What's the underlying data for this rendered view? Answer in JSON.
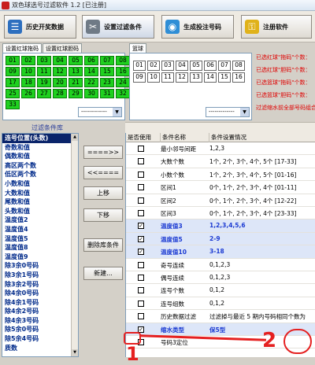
{
  "window": {
    "title": "双色球选号过滤软件 1.2 [已注册]"
  },
  "toolbar": [
    {
      "label": "历史开奖数据",
      "icon": "folder-icon",
      "color": "#2d6fbf",
      "glyph": "☰"
    },
    {
      "label": "设置过滤条件",
      "icon": "tools-icon",
      "color": "#6f7a86",
      "glyph": "✂"
    },
    {
      "label": "生成投注号码",
      "icon": "lottery-icon",
      "color": "#2f8ed6",
      "glyph": "◉"
    },
    {
      "label": "注册软件",
      "icon": "key-icon",
      "color": "#e0b21a",
      "glyph": "⚿"
    }
  ],
  "red_tabs": [
    "设置红球拖码",
    "设置红球胆码"
  ],
  "red_numbers": [
    "01",
    "02",
    "03",
    "04",
    "05",
    "06",
    "07",
    "08",
    "09",
    "10",
    "11",
    "12",
    "13",
    "14",
    "15",
    "16",
    "17",
    "18",
    "19",
    "20",
    "21",
    "22",
    "23",
    "24",
    "25",
    "26",
    "27",
    "28",
    "29",
    "30",
    "31",
    "32",
    "33"
  ],
  "blue_tabs": [
    "篮球"
  ],
  "blue_numbers": [
    "01",
    "02",
    "03",
    "04",
    "05",
    "06",
    "07",
    "08",
    "09",
    "10",
    "11",
    "12",
    "13",
    "14",
    "15",
    "16"
  ],
  "red_select_value": "-------------",
  "blue_select_value": "-------------",
  "status_lines": [
    "已选红球\"拖码\"个数：",
    "已选红球\"胆码\"个数：",
    "已选篮球\"拖码\"个数：",
    "已选篮球\"胆码\"个数：",
    "过滤缩水前全部号码组合"
  ],
  "library": {
    "header": "过滤条件库",
    "items": [
      "连号位置(头数)",
      "奇数和值",
      "偶数和值",
      "高区两个数",
      "低区两个数",
      "小数和值",
      "大数和值",
      "尾数和值",
      "头数和值",
      "温度值2",
      "温度值4",
      "温度值5",
      "温度值8",
      "温度值9",
      "除3余0号码",
      "除3余1号码",
      "除3余2号码",
      "除4余0号码",
      "除4余1号码",
      "除4余2号码",
      "除4余3号码",
      "除5余0号码",
      "除5余4号码",
      "质数"
    ],
    "selected_index": 0
  },
  "buttons": {
    "add": "====>>",
    "remove": "<<====",
    "up": "上移",
    "down": "下移",
    "delete": "删除库条件",
    "new": "新建..."
  },
  "table": {
    "headers": [
      "是否使用",
      "条件名称",
      "条件设置情况"
    ],
    "rows": [
      {
        "checked": false,
        "name": "最小邻号间距",
        "cond": "1,2,3",
        "highlight": false,
        "blue": false
      },
      {
        "checked": false,
        "name": "大数个数",
        "cond": "1个, 2个, 3个, 4个, 5个   [17-33]",
        "highlight": false,
        "blue": false
      },
      {
        "checked": false,
        "name": "小数个数",
        "cond": "1个, 2个, 3个, 4个, 5个   [01-16]",
        "highlight": false,
        "blue": false
      },
      {
        "checked": false,
        "name": "区间1",
        "cond": "0个, 1个, 2个, 3个, 4个   [01-11]",
        "highlight": false,
        "blue": false
      },
      {
        "checked": false,
        "name": "区间2",
        "cond": "0个, 1个, 2个, 3个, 4个   [12-22]",
        "highlight": false,
        "blue": false
      },
      {
        "checked": false,
        "name": "区间3",
        "cond": "0个, 1个, 2个, 3个, 4个   [23-33]",
        "highlight": false,
        "blue": false
      },
      {
        "checked": true,
        "name": "温度值3",
        "cond": "1,2,3,4,5,6",
        "highlight": true,
        "blue": true
      },
      {
        "checked": true,
        "name": "温度值5",
        "cond": "2-9",
        "highlight": true,
        "blue": true
      },
      {
        "checked": true,
        "name": "温度值10",
        "cond": "3-18",
        "highlight": true,
        "blue": true
      },
      {
        "checked": false,
        "name": "奇号连续",
        "cond": "0,1,2,3",
        "highlight": false,
        "blue": false
      },
      {
        "checked": false,
        "name": "偶号连续",
        "cond": "0,1,2,3",
        "highlight": false,
        "blue": false
      },
      {
        "checked": false,
        "name": "连号个数",
        "cond": "0,1,2",
        "highlight": false,
        "blue": false
      },
      {
        "checked": false,
        "name": "连号组数",
        "cond": "0,1,2",
        "highlight": false,
        "blue": false
      },
      {
        "checked": false,
        "name": "历史数据过滤",
        "cond": "过滤掉与最近 5 期内号码相同个数为",
        "highlight": false,
        "blue": false
      },
      {
        "checked": true,
        "name": "缩水类型",
        "cond": "保5型",
        "highlight": true,
        "blue": true
      },
      {
        "checked": false,
        "name": "号码3定位",
        "cond": "",
        "highlight": false,
        "blue": false
      }
    ]
  },
  "annotations": [
    "1",
    "2"
  ]
}
